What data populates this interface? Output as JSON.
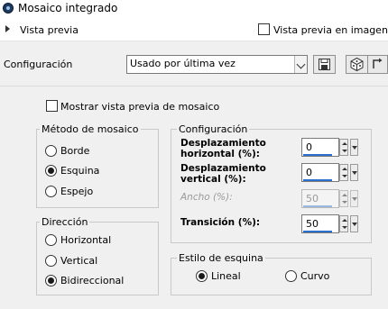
{
  "window": {
    "title": "Mosaico integrado"
  },
  "preview": {
    "label": "Vista previa",
    "image_preview_label": "Vista previa en imagen",
    "image_preview_checked": false
  },
  "configuration": {
    "label": "Configuración",
    "preset_value": "Usado por última vez"
  },
  "toolbar_icons": [
    "save-icon",
    "random-dice-icon",
    "reset-icon"
  ],
  "mosaic_preview": {
    "label": "Mostrar vista previa de mosaico",
    "checked": false
  },
  "mosaic_method": {
    "title": "Método de mosaico",
    "options": [
      {
        "label": "Borde",
        "selected": false
      },
      {
        "label": "Esquina",
        "selected": true
      },
      {
        "label": "Espejo",
        "selected": false
      }
    ]
  },
  "direction": {
    "title": "Dirección",
    "options": [
      {
        "label": "Horizontal",
        "selected": false
      },
      {
        "label": "Vertical",
        "selected": false
      },
      {
        "label": "Bidireccional",
        "selected": true
      }
    ]
  },
  "settings": {
    "title": "Configuración",
    "horizontal_shift": {
      "label": "Desplazamiento horizontal (%):",
      "value": "0"
    },
    "vertical_shift": {
      "label": "Desplazamiento vertical (%):",
      "value": "0"
    },
    "width": {
      "label": "Ancho (%):",
      "value": "50",
      "disabled": true
    },
    "transition": {
      "label": "Transición (%):",
      "value": "50"
    }
  },
  "corner_style": {
    "title": "Estilo de esquina",
    "options": [
      {
        "label": "Lineal",
        "selected": true
      },
      {
        "label": "Curvo",
        "selected": false
      }
    ]
  },
  "colors": {
    "accent_bar": "#2a6fc9",
    "panel_bg": "#f0f0f0",
    "header_bg": "#ffffff"
  }
}
